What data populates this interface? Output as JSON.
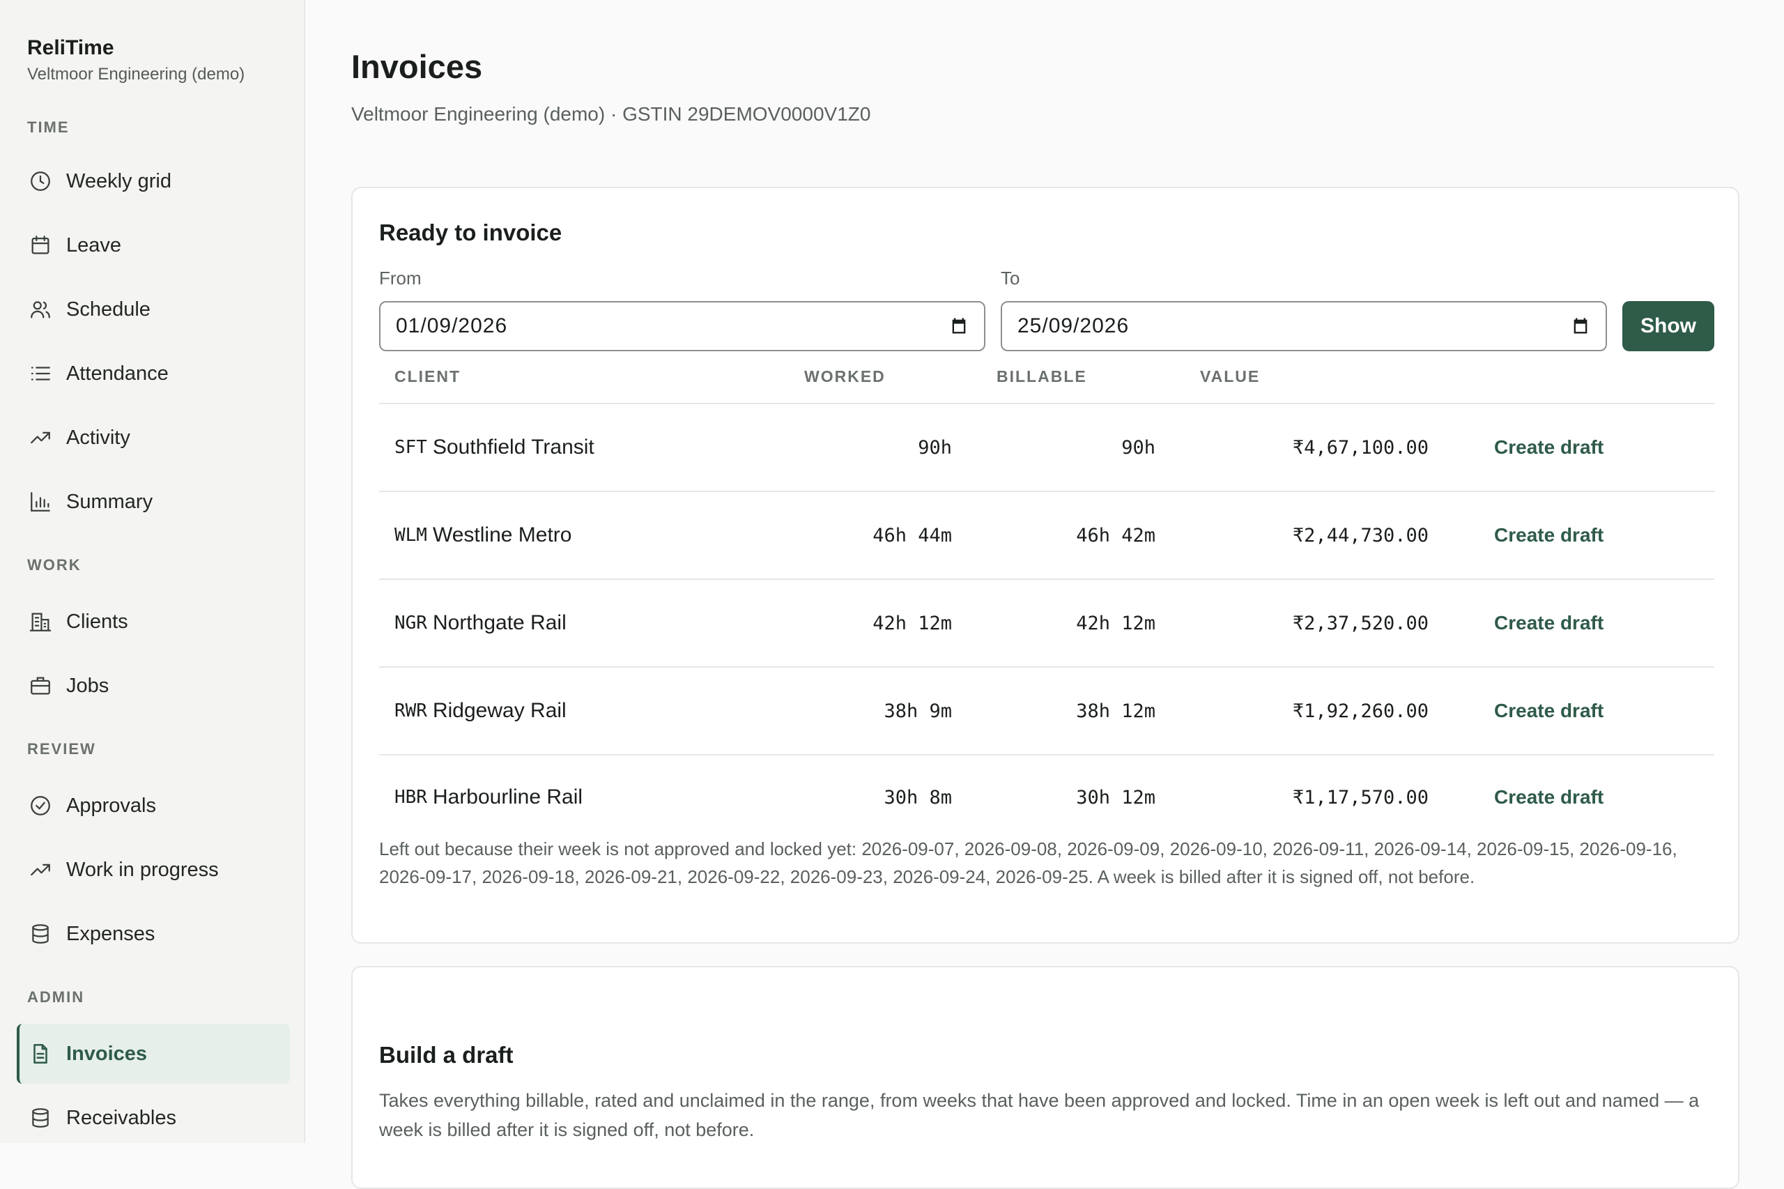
{
  "sidebar": {
    "brand_title": "ReliTime",
    "brand_subtitle": "Veltmoor Engineering (demo)",
    "sections": {
      "time": "TIME",
      "work": "WORK",
      "review": "REVIEW",
      "admin": "ADMIN"
    },
    "items": {
      "weekly_grid": "Weekly grid",
      "leave": "Leave",
      "schedule": "Schedule",
      "attendance": "Attendance",
      "activity": "Activity",
      "summary": "Summary",
      "clients": "Clients",
      "jobs": "Jobs",
      "approvals": "Approvals",
      "work_in_progress": "Work in progress",
      "expenses": "Expenses",
      "invoices": "Invoices",
      "receivables": "Receivables"
    },
    "active_item": "invoices",
    "accent_color": "#2f5b49"
  },
  "page": {
    "title": "Invoices",
    "subtitle": "Veltmoor Engineering (demo) · GSTIN 29DEMOV0000V1Z0"
  },
  "ready": {
    "title": "Ready to invoice",
    "from_label": "From",
    "from_value": "01/09/2026",
    "to_label": "To",
    "to_value": "25/09/2026",
    "show_label": "Show",
    "columns": {
      "client": "CLIENT",
      "worked": "WORKED",
      "billable": "BILLABLE",
      "value": "VALUE"
    },
    "action_label": "Create draft",
    "rows": [
      {
        "code": "SFT",
        "name": "Southfield Transit",
        "worked": "90h",
        "billable": "90h",
        "value": "₹4,67,100.00"
      },
      {
        "code": "WLM",
        "name": "Westline Metro",
        "worked": "46h 44m",
        "billable": "46h 42m",
        "value": "₹2,44,730.00"
      },
      {
        "code": "NGR",
        "name": "Northgate Rail",
        "worked": "42h 12m",
        "billable": "42h 12m",
        "value": "₹2,37,520.00"
      },
      {
        "code": "RWR",
        "name": "Ridgeway Rail",
        "worked": "38h 9m",
        "billable": "38h 12m",
        "value": "₹1,92,260.00"
      },
      {
        "code": "HBR",
        "name": "Harbourline Rail",
        "worked": "30h 8m",
        "billable": "30h 12m",
        "value": "₹1,17,570.00"
      }
    ],
    "note": "Left out because their week is not approved and locked yet: 2026-09-07, 2026-09-08, 2026-09-09, 2026-09-10, 2026-09-11, 2026-09-14, 2026-09-15, 2026-09-16, 2026-09-17, 2026-09-18, 2026-09-21, 2026-09-22, 2026-09-23, 2026-09-24, 2026-09-25. A week is billed after it is signed off, not before."
  },
  "draft": {
    "title": "Build a draft",
    "description": "Takes everything billable, rated and unclaimed in the range, from weeks that have been approved and locked. Time in an open week is left out and named — a week is billed after it is signed off, not before."
  }
}
